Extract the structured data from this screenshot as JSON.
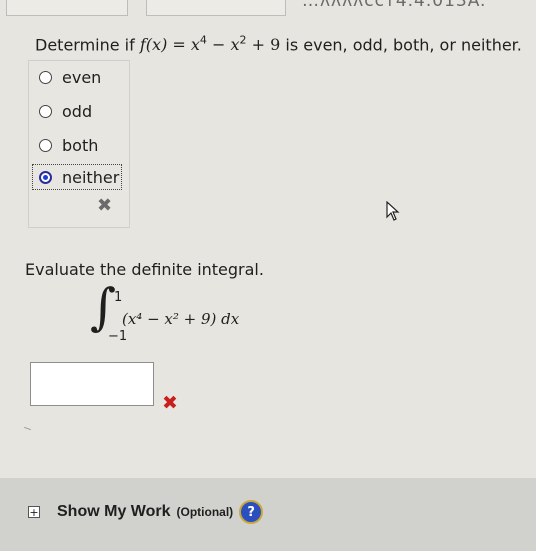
{
  "top_partial_text": "…ᴧᴧᴧᴧᴄᴄᴛ4.4.013A.",
  "question": {
    "lead": "Determine if",
    "func": "f",
    "var": "x",
    "exp4": "4",
    "exp2": "2",
    "const": "9",
    "tail": "is even, odd, both, or neither."
  },
  "choices": [
    {
      "label": "even",
      "selected": false
    },
    {
      "label": "odd",
      "selected": false
    },
    {
      "label": "both",
      "selected": false
    },
    {
      "label": "neither",
      "selected": true
    }
  ],
  "feedback_icon": "x-mark-icon",
  "evaluate": {
    "prompt": "Evaluate the definite integral.",
    "upper_limit": "1",
    "lower_limit": "−1",
    "integrand": "(x⁴ − x² + 9) dx",
    "answer_value": ""
  },
  "footer": {
    "show_work_label": "Show My Work",
    "optional_label": "(Optional)",
    "help_text": "?"
  },
  "colors": {
    "incorrect": "#c81e1e",
    "selected_radio": "#1a3fd6",
    "help_bg": "#2c4fbf"
  }
}
